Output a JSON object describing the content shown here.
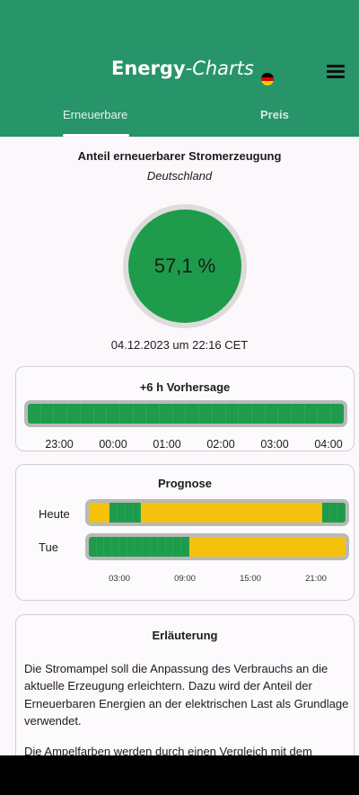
{
  "header": {
    "brand_bold": "Energy",
    "brand_rest": "-Charts",
    "menu_icon": "hamburger-menu-icon",
    "flag_colors": [
      "#000000",
      "#dd0000",
      "#ffce00"
    ],
    "background": "#27946a"
  },
  "tabs": [
    {
      "label": "Erneuerbare",
      "active": true
    },
    {
      "label": "Preis",
      "active": false
    }
  ],
  "share": {
    "title": "Anteil erneuerbarer Stromerzeugung",
    "country": "Deutschland",
    "value": "57,1 %",
    "timestamp": "04.12.2023 um 22:16 CET",
    "color": "#1e9c4b"
  },
  "forecast": {
    "title": "+6 h Vorhersage",
    "segments": [
      "green",
      "green",
      "green",
      "green",
      "green",
      "green",
      "green",
      "green",
      "green",
      "green",
      "green",
      "green",
      "green",
      "green",
      "green",
      "green",
      "green",
      "green",
      "green",
      "green",
      "green",
      "green",
      "green",
      "green"
    ],
    "hours": [
      "23:00",
      "00:00",
      "01:00",
      "02:00",
      "03:00",
      "04:00"
    ]
  },
  "prognose": {
    "title": "Prognose",
    "rows": [
      {
        "label": "Heute",
        "segments": [
          "yellow",
          "yellow",
          "yellow",
          "green",
          "green",
          "green",
          "green",
          "yellow",
          "yellow",
          "yellow",
          "yellow",
          "yellow",
          "yellow",
          "yellow",
          "yellow",
          "yellow",
          "yellow",
          "yellow",
          "yellow",
          "yellow",
          "yellow",
          "yellow",
          "yellow",
          "yellow",
          "yellow",
          "yellow",
          "yellow",
          "yellow",
          "yellow",
          "yellow",
          "yellow",
          "yellow",
          "yellow",
          "green",
          "green",
          "green"
        ]
      },
      {
        "label": "Tue",
        "segments": [
          "green",
          "green",
          "green",
          "green",
          "green",
          "green",
          "green",
          "green",
          "green",
          "green",
          "green",
          "green",
          "green",
          "yellow",
          "yellow",
          "yellow",
          "yellow",
          "yellow",
          "yellow",
          "yellow",
          "yellow",
          "yellow",
          "yellow",
          "yellow",
          "yellow",
          "yellow",
          "yellow",
          "yellow",
          "yellow",
          "yellow",
          "yellow",
          "yellow",
          "yellow",
          "yellow",
          "yellow",
          "yellow"
        ]
      }
    ],
    "ticks": [
      "03:00",
      "09:00",
      "15:00",
      "21:00"
    ],
    "colors": {
      "green": "#1e9c4b",
      "yellow": "#f4c20d"
    }
  },
  "explanation": {
    "title": "Erläuterung",
    "paragraph1": "Die Stromampel soll die Anpassung des Verbrauchs an die aktuelle Erzeugung erleichtern. Dazu wird der Anteil der Erneuerbaren Energien an der elektrischen Last als Grundlage verwendet.",
    "paragraph2": "Die Ampelfarben werden durch einen Vergleich mit dem Mittelwert des monatlichen Anteils der Erneuerbaren"
  }
}
